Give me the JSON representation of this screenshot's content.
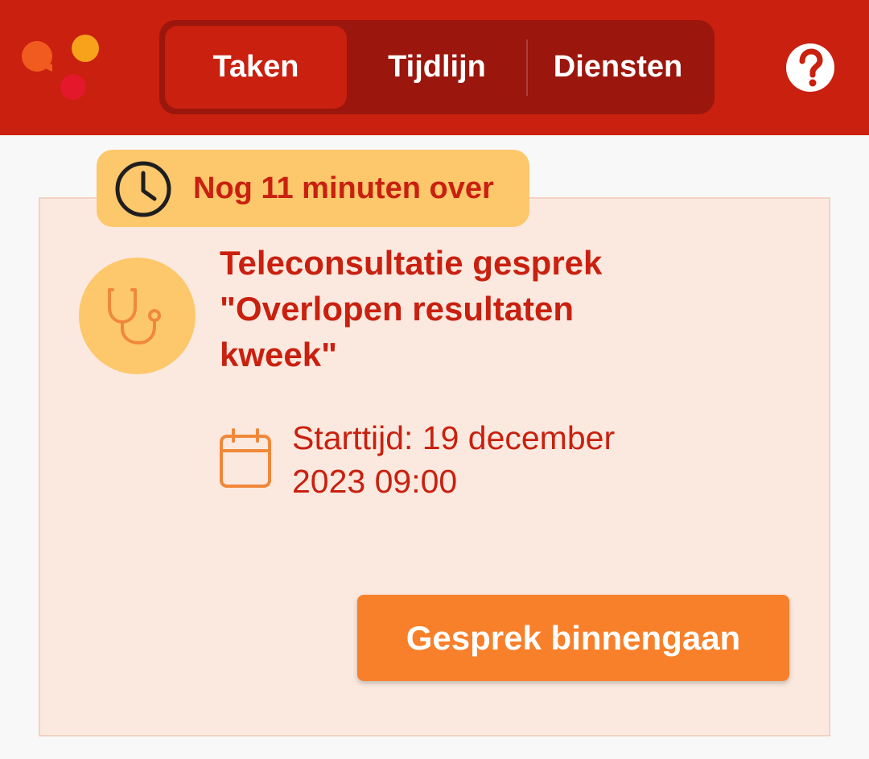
{
  "header": {
    "logo_icon": "app-logo-icon",
    "tabs": [
      {
        "label": "Taken",
        "active": true
      },
      {
        "label": "Tijdlijn",
        "active": false
      },
      {
        "label": "Diensten",
        "active": false
      }
    ],
    "help_icon": "help-icon"
  },
  "task": {
    "timer_text": "Nog 11 minuten over",
    "timer_icon": "clock-icon",
    "type_icon": "stethoscope-icon",
    "title": "Teleconsultatie gesprek \"Overlopen resultaten kweek\"",
    "start_icon": "calendar-icon",
    "start_time": "Starttijd: 19 december 2023 09:00",
    "action_label": "Gesprek binnengaan"
  },
  "colors": {
    "header_red": "#c9200f",
    "tab_bar_dark": "#9b160c",
    "badge_yellow": "#fdc76c",
    "card_bg": "#fbe9df",
    "button_orange": "#f8802a",
    "icon_orange": "#f0883a"
  }
}
